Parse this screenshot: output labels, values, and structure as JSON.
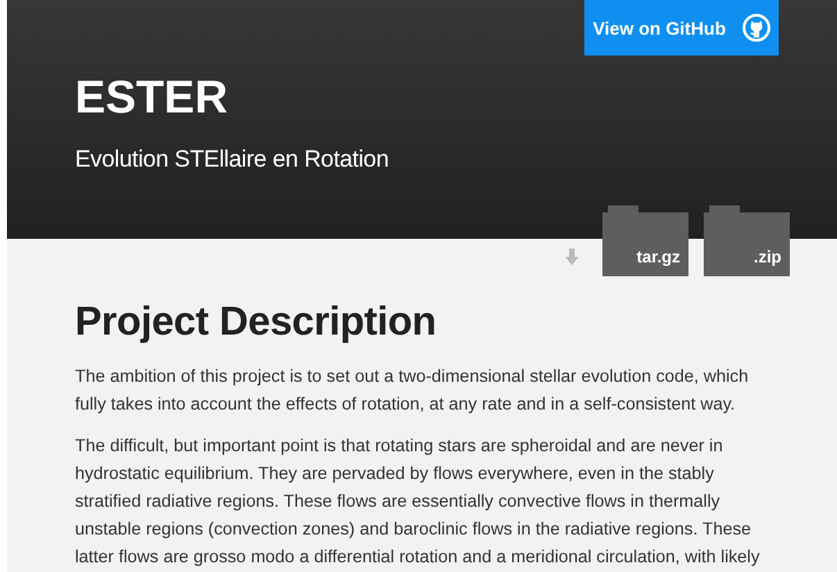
{
  "header": {
    "title": "ESTER",
    "subtitle": "Evolution STEllaire en Rotation",
    "github_button": "View on GitHub"
  },
  "downloads": [
    {
      "label": "tar.gz"
    },
    {
      "label": ".zip"
    }
  ],
  "section": {
    "heading": "Project Description",
    "paragraphs": [
      "The ambition of this project is to set out a two-dimensional stellar evolution code, which fully takes into account the effects of rotation, at any rate and in a self-consistent way.",
      "The difficult, but important point is that rotating stars are spheroidal and are never in hydrostatic equilibrium. They are pervaded by flows everywhere, even in the stably stratified radiative regions. These flows are essentially convective flows in thermally unstable regions (convection zones) and baroclinic flows in the radiative regions. These latter flows are grosso modo a differential rotation and a meridional circulation, with likely"
    ]
  }
}
